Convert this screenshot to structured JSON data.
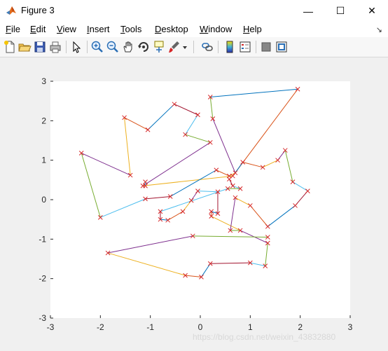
{
  "window": {
    "title": "Figure 3",
    "minimize_glyph": "—",
    "maximize_glyph": "☐",
    "close_glyph": "✕"
  },
  "menu": [
    "File",
    "Edit",
    "View",
    "Insert",
    "Tools",
    "Desktop",
    "Window",
    "Help"
  ],
  "menu_underline": [
    "F",
    "E",
    "V",
    "I",
    "T",
    "D",
    "W",
    "H"
  ],
  "dock_glyph": "↘",
  "toolbar": {
    "icons": [
      "new-figure-icon",
      "open-file-icon",
      "save-icon",
      "print-icon",
      "pointer-icon",
      "zoom-in-icon",
      "zoom-out-icon",
      "pan-icon",
      "rotate-3d-icon",
      "data-cursor-icon",
      "brush-icon",
      "brush-dropdown-icon",
      "link-plot-icon",
      "colorbar-icon",
      "legend-icon",
      "hide-plot-tools-icon",
      "show-plot-tools-icon"
    ]
  },
  "watermark": "https://blog.csdn.net/weixin_43832880",
  "chart_data": {
    "type": "line",
    "xlim": [
      -3,
      3
    ],
    "ylim": [
      -3,
      3
    ],
    "x_ticks": [
      -3,
      -2,
      -1,
      0,
      1,
      2,
      3
    ],
    "y_ticks": [
      -3,
      -2,
      -1,
      0,
      1,
      2,
      3
    ],
    "grid": false,
    "marker": "x",
    "marker_color": "#d62728",
    "colors": [
      "#0072bd",
      "#d95319",
      "#edb120",
      "#7e2f8e",
      "#77ac30",
      "#4dbeee",
      "#a2142f"
    ],
    "path": [
      [
        0.2,
        2.6
      ],
      [
        1.95,
        2.8
      ],
      [
        0.65,
        0.6
      ],
      [
        -1.15,
        0.35
      ],
      [
        0.2,
        1.45
      ],
      [
        -0.3,
        1.65
      ],
      [
        -0.05,
        2.15
      ],
      [
        -0.52,
        2.42
      ],
      [
        -1.05,
        1.77
      ],
      [
        -1.52,
        2.08
      ],
      [
        -1.4,
        0.62
      ],
      [
        -2.38,
        1.18
      ],
      [
        -2.0,
        -0.45
      ],
      [
        -1.1,
        0.02
      ],
      [
        -0.6,
        0.08
      ],
      [
        0.32,
        0.75
      ],
      [
        0.58,
        0.6
      ],
      [
        0.7,
        0.68
      ],
      [
        0.25,
        2.05
      ],
      [
        0.2,
        2.6
      ]
    ],
    "segments": [
      [
        [
          -0.05,
          0.22
        ],
        [
          0.35,
          0.2
        ]
      ],
      [
        [
          0.35,
          0.2
        ],
        [
          0.35,
          -0.35
        ]
      ],
      [
        [
          0.35,
          -0.35
        ],
        [
          0.22,
          -0.3
        ]
      ],
      [
        [
          0.22,
          -0.3
        ],
        [
          0.22,
          -0.42
        ]
      ],
      [
        [
          0.22,
          -0.42
        ],
        [
          0.8,
          -0.78
        ]
      ],
      [
        [
          0.8,
          -0.78
        ],
        [
          1.35,
          -1.1
        ]
      ],
      [
        [
          1.35,
          -1.1
        ],
        [
          1.3,
          -1.68
        ]
      ],
      [
        [
          1.3,
          -1.68
        ],
        [
          1.0,
          -1.6
        ]
      ],
      [
        [
          1.0,
          -1.6
        ],
        [
          0.2,
          -1.62
        ]
      ],
      [
        [
          0.2,
          -1.62
        ],
        [
          0.02,
          -1.96
        ]
      ],
      [
        [
          0.02,
          -1.96
        ],
        [
          -0.3,
          -1.92
        ]
      ],
      [
        [
          -0.3,
          -1.92
        ],
        [
          -1.85,
          -1.35
        ]
      ],
      [
        [
          -1.85,
          -1.35
        ],
        [
          -0.15,
          -0.92
        ]
      ],
      [
        [
          -0.15,
          -0.92
        ],
        [
          1.35,
          -0.95
        ]
      ],
      [
        [
          -0.8,
          -0.3
        ],
        [
          0.55,
          0.28
        ]
      ],
      [
        [
          -0.8,
          -0.3
        ],
        [
          -0.8,
          -0.5
        ]
      ],
      [
        [
          -0.8,
          -0.5
        ],
        [
          -0.65,
          -0.52
        ]
      ],
      [
        [
          -0.65,
          -0.52
        ],
        [
          -0.35,
          -0.3
        ]
      ],
      [
        [
          -0.35,
          -0.3
        ],
        [
          -0.18,
          -0.02
        ]
      ],
      [
        [
          -0.18,
          -0.02
        ],
        [
          -0.05,
          0.22
        ]
      ],
      [
        [
          0.55,
          0.28
        ],
        [
          0.8,
          0.28
        ]
      ],
      [
        [
          0.8,
          0.28
        ],
        [
          0.65,
          0.35
        ]
      ],
      [
        [
          0.65,
          0.35
        ],
        [
          0.58,
          0.52
        ]
      ],
      [
        [
          0.7,
          0.68
        ],
        [
          0.85,
          0.95
        ]
      ],
      [
        [
          0.85,
          0.95
        ],
        [
          1.25,
          0.82
        ]
      ],
      [
        [
          1.25,
          0.82
        ],
        [
          1.55,
          1.0
        ]
      ],
      [
        [
          1.55,
          1.0
        ],
        [
          1.7,
          1.25
        ]
      ],
      [
        [
          1.7,
          1.25
        ],
        [
          1.85,
          0.45
        ]
      ],
      [
        [
          1.85,
          0.45
        ],
        [
          2.15,
          0.22
        ]
      ],
      [
        [
          2.15,
          0.22
        ],
        [
          1.9,
          -0.15
        ]
      ],
      [
        [
          1.9,
          -0.15
        ],
        [
          1.35,
          -0.68
        ]
      ],
      [
        [
          1.35,
          -0.68
        ],
        [
          1.0,
          -0.15
        ]
      ],
      [
        [
          1.0,
          -0.15
        ],
        [
          0.7,
          0.05
        ]
      ],
      [
        [
          0.7,
          0.05
        ],
        [
          0.6,
          -0.78
        ]
      ],
      [
        [
          0.6,
          -0.78
        ],
        [
          0.8,
          -0.78
        ]
      ],
      [
        [
          -1.1,
          0.45
        ],
        [
          -1.1,
          0.35
        ]
      ]
    ]
  }
}
